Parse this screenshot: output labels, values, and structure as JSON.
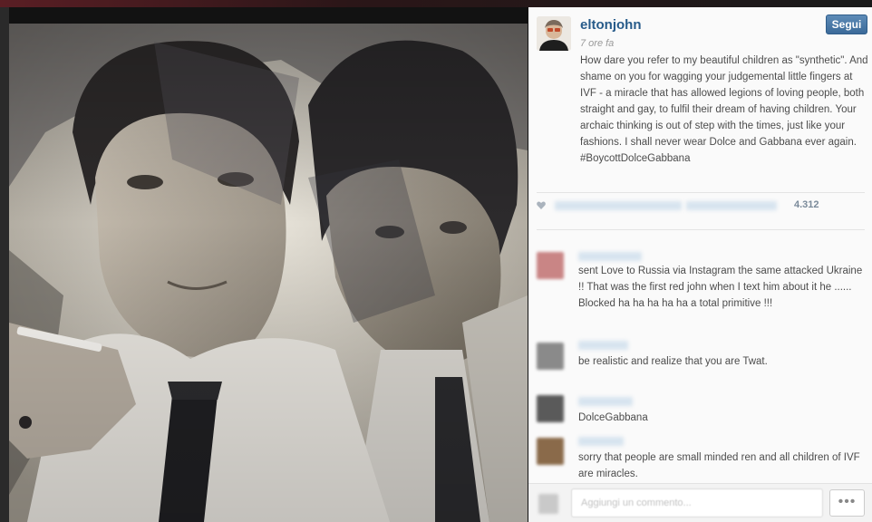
{
  "post": {
    "username": "eltonjohn",
    "follow_label": "Segui",
    "time": "7 ore fa",
    "caption": "How dare you refer to my beautiful children as \"synthetic\". And shame on you for wagging your judgemental little fingers at IVF - a miracle that has allowed legions of loving people, both straight and gay, to fulfil their dream of having children. Your archaic thinking is out of step with the times, just like your fashions. I shall never wear Dolce and Gabbana ever again. #BoycottDolceGabbana"
  },
  "likes": {
    "count": "4.312"
  },
  "comments": [
    {
      "text": "sent Love to Russia via Instagram the same attacked Ukraine !! That was the first red john when I text him about it he ...... Blocked ha ha ha ha ha a total primitive !!!",
      "avatar_color": "#c98585"
    },
    {
      "text": "be realistic and realize that you are Twat.",
      "avatar_color": "#8a8a8a"
    },
    {
      "text": "DolceGabbana",
      "avatar_color": "#5a5a5a"
    },
    {
      "text": "sorry that people are small minded ren and all children of IVF are miracles.",
      "avatar_color": "#8a6a4a"
    }
  ],
  "comment_input": {
    "placeholder": "Aggiungi un commento..."
  },
  "more_label": "•••",
  "colors": {
    "accent": "#275b8a",
    "button": "#3b6a99"
  }
}
